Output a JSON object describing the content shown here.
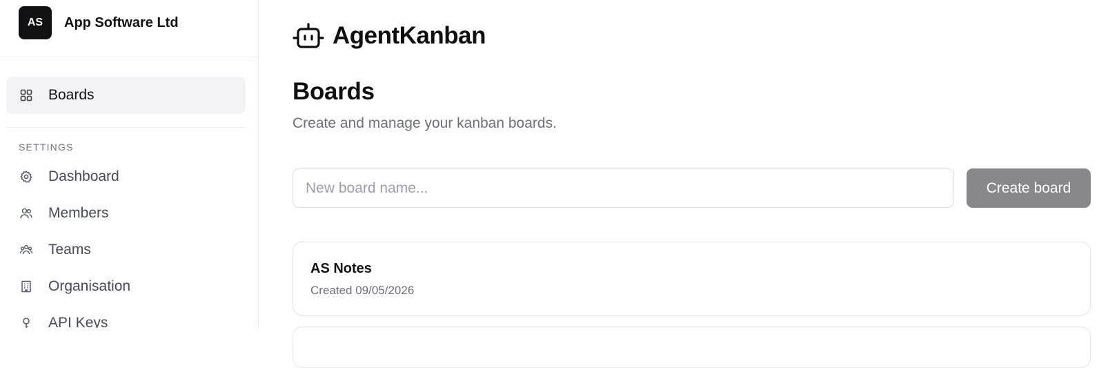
{
  "org": {
    "initials": "AS",
    "name": "App Software Ltd"
  },
  "sidebar": {
    "primary": [
      {
        "label": "Boards",
        "icon": "grid-icon",
        "active": true
      }
    ],
    "section_label": "SETTINGS",
    "settings": [
      {
        "label": "Dashboard",
        "icon": "gear-icon"
      },
      {
        "label": "Members",
        "icon": "users-icon"
      },
      {
        "label": "Teams",
        "icon": "team-icon"
      },
      {
        "label": "Organisation",
        "icon": "building-icon"
      },
      {
        "label": "API Keys",
        "icon": "key-icon"
      }
    ]
  },
  "brand": {
    "name": "AgentKanban",
    "icon": "robot-icon"
  },
  "page": {
    "title": "Boards",
    "subtitle": "Create and manage your kanban boards."
  },
  "create": {
    "placeholder": "New board name...",
    "button_label": "Create board"
  },
  "boards": [
    {
      "name": "AS Notes",
      "created": "Created 09/05/2026"
    }
  ],
  "colors": {
    "accent_dark": "#111114",
    "button_disabled": "#87878c",
    "active_bg": "#f3f3f5"
  }
}
